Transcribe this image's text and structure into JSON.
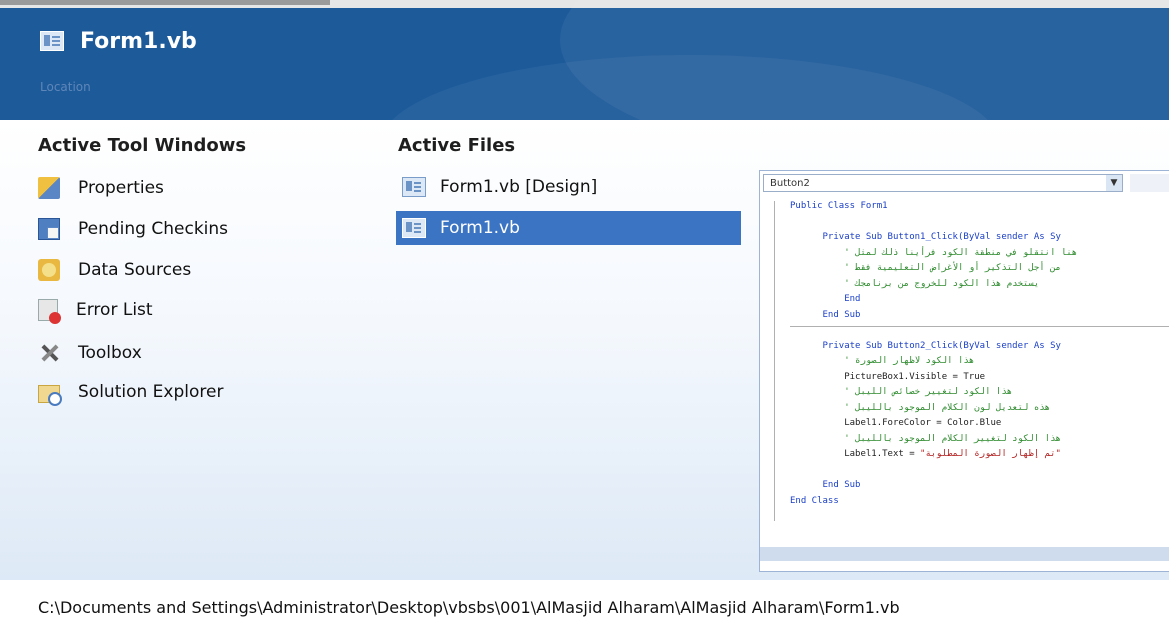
{
  "header": {
    "title": "Form1.vb",
    "subtitle": "Location"
  },
  "tool_windows": {
    "heading": "Active Tool Windows",
    "items": [
      {
        "label": "Properties",
        "icon": "properties-icon"
      },
      {
        "label": "Pending Checkins",
        "icon": "pending-checkins-icon"
      },
      {
        "label": "Data Sources",
        "icon": "data-sources-icon"
      },
      {
        "label": "Error List",
        "icon": "error-list-icon"
      },
      {
        "label": "Toolbox",
        "icon": "toolbox-icon"
      },
      {
        "label": "Solution Explorer",
        "icon": "solution-explorer-icon"
      }
    ]
  },
  "active_files": {
    "heading": "Active Files",
    "items": [
      {
        "label": "Form1.vb [Design]",
        "selected": false
      },
      {
        "label": "Form1.vb",
        "selected": true
      }
    ]
  },
  "preview": {
    "combo_value": "Button2",
    "code": {
      "line1": "Public Class Form1",
      "sub1_decl": "Private Sub Button1_Click(ByVal sender As Sy",
      "sub1_c1": "' هنا انتقلو في منطقة الكود فرأينا ذلك لمثل",
      "sub1_c2": "' من أجل التذكير أو الأغراض التعليمية فقط",
      "sub1_c3": "' يستخدم هذا الكود للخروج من برنامجك",
      "sub1_end": "End",
      "sub1_endsub": "End Sub",
      "sub2_decl": "Private Sub Button2_Click(ByVal sender As Sy",
      "sub2_c1": "' هذا الكود لاظهار الصورة",
      "sub2_s1": "PictureBox1.Visible = True",
      "sub2_c2": "' هذا الكود لتغيير خصائص الليبل",
      "sub2_c3": "' هذه لتعديل لون الكلام الموجود بالليبل",
      "sub2_s2": "Label1.ForeColor = Color.Blue",
      "sub2_c4": "' هذا الكود لتغيير الكلام الموجود بالليبل",
      "sub2_s3a": "Label1.Text = ",
      "sub2_s3b": "\"تم إظهار الصورة المطلوبة\"",
      "sub2_endsub": "End Sub",
      "end_class": "End Class"
    }
  },
  "footer": {
    "path": "C:\\Documents and Settings\\Administrator\\Desktop\\vbsbs\\001\\AlMasjid Alharam\\AlMasjid Alharam\\Form1.vb"
  },
  "colors": {
    "header_bg": "#1c5a9a",
    "selection_bg": "#3c74c4",
    "keyword": "#1a3fc8",
    "comment": "#2e8b2e",
    "string": "#b22222"
  }
}
